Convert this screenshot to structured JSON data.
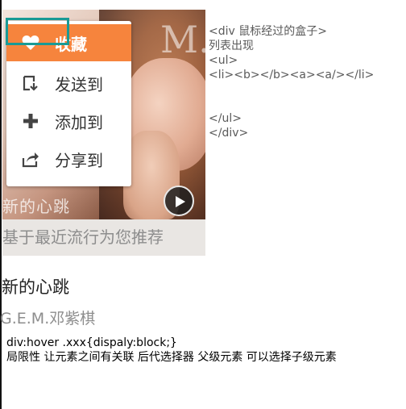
{
  "cover": {
    "letter": "M.",
    "logo_text": "新的心跳"
  },
  "menu": {
    "items": [
      {
        "label": "收藏",
        "icon": "heart-icon",
        "active": true
      },
      {
        "label": "发送到",
        "icon": "send-to-icon",
        "active": false
      },
      {
        "label": "添加到",
        "icon": "plus-icon",
        "active": false
      },
      {
        "label": "分享到",
        "icon": "share-icon",
        "active": false
      }
    ]
  },
  "card": {
    "recommend_text": "基于最近流行为您推荐"
  },
  "code_lines": [
    "<div 鼠标经过的盒子>",
    "列表出现",
    "<ul>",
    "<li><b></b><a><a/></li>",
    "",
    "",
    "</ul>",
    "</div>"
  ],
  "song": {
    "title": "新的心跳",
    "artist": "G.E.M.邓紫棋"
  },
  "notes": [
    "div:hover .xxx{dispaly:block;}",
    "局限性 让元素之间有关联 后代选择器 父级元素 可以选择子级元素"
  ],
  "colors": {
    "accent": "#f6843d",
    "highlight": "#199a95"
  }
}
